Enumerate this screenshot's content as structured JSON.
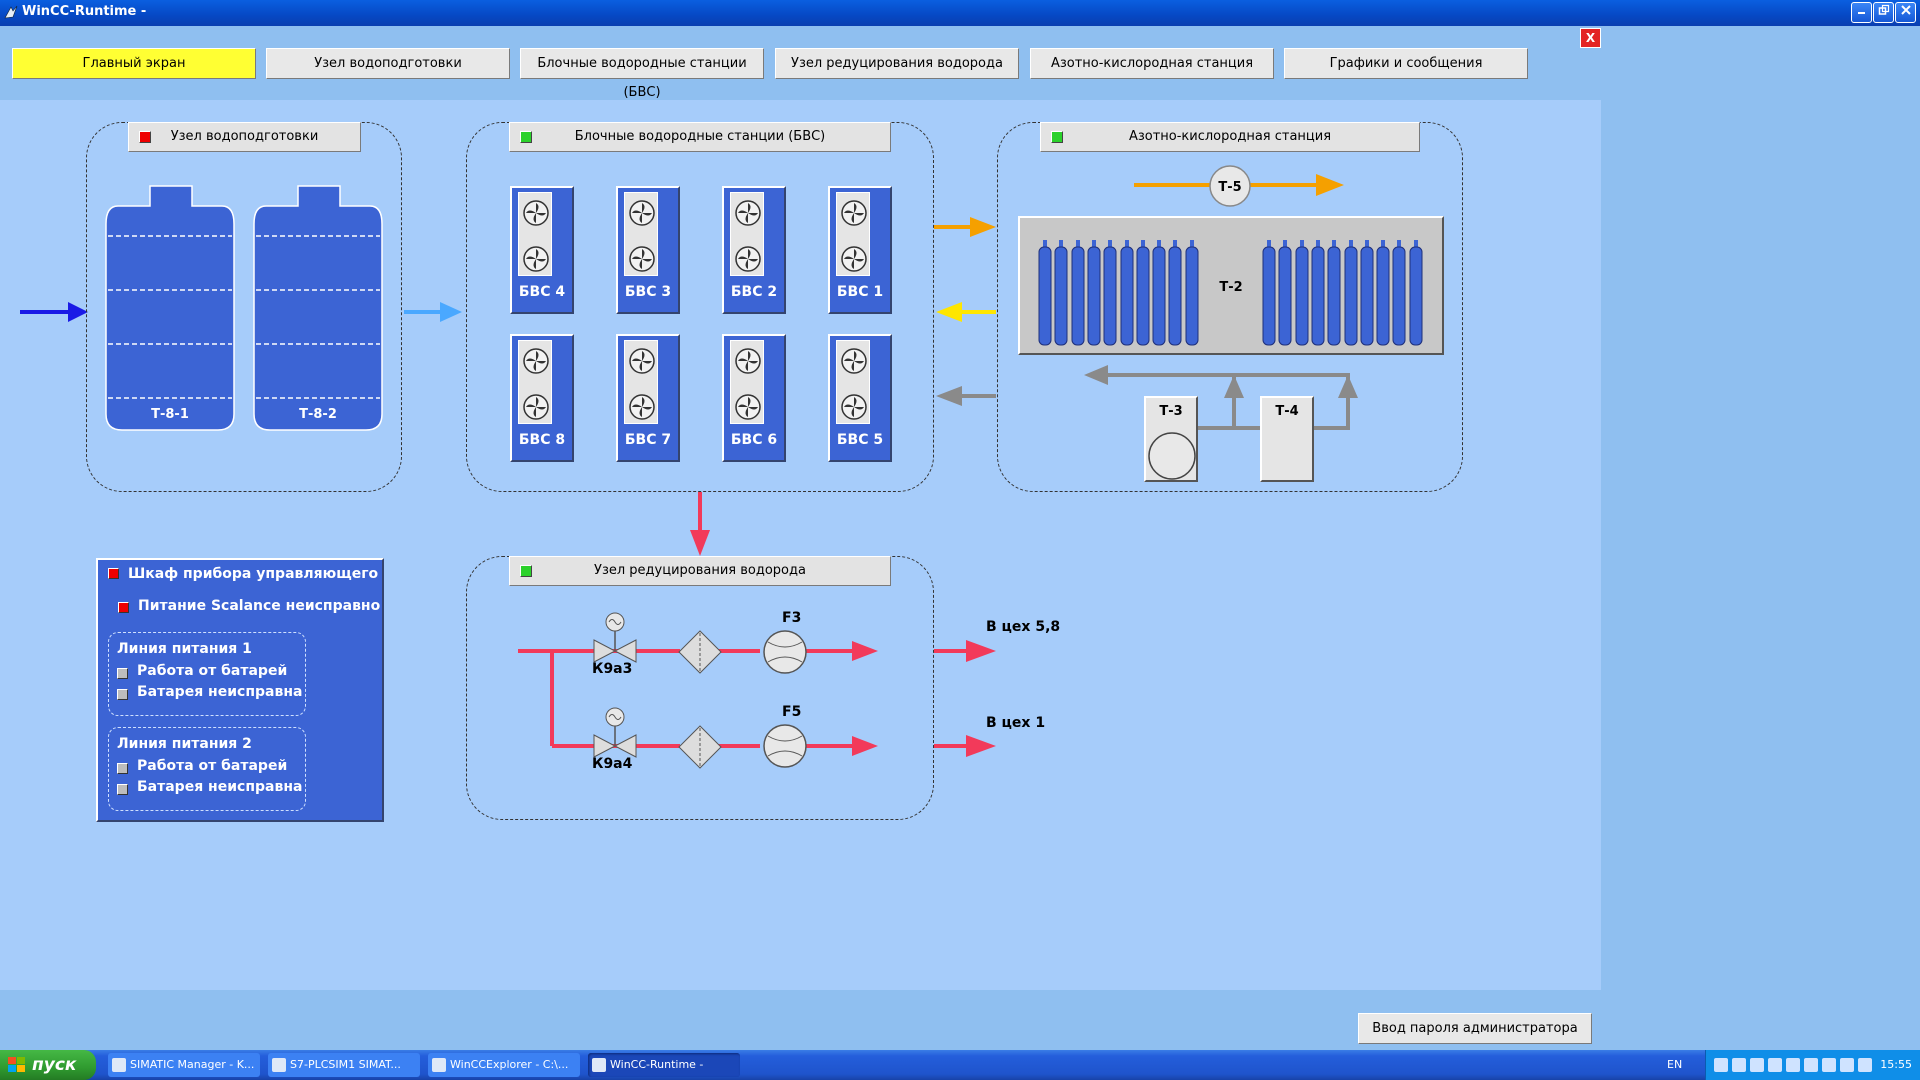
{
  "window": {
    "title": "WinCC-Runtime -",
    "close_label": "X"
  },
  "nav": [
    {
      "label": "Главный экран",
      "active": true
    },
    {
      "label": "Узел водоподготовки"
    },
    {
      "label": "Блочные водородные станции (БВС)"
    },
    {
      "label": "Узел редуцирования водорода"
    },
    {
      "label": "Азотно-кислородная станция"
    },
    {
      "label": "Графики и сообщения"
    }
  ],
  "water": {
    "title": "Узел водоподготовки",
    "status": "red",
    "tanks": [
      "Т-8-1",
      "Т-8-2"
    ]
  },
  "bvs": {
    "title": "Блочные водородные станции (БВС)",
    "status": "green",
    "units": [
      "БВС 4",
      "БВС 3",
      "БВС 2",
      "БВС 1",
      "БВС 8",
      "БВС 7",
      "БВС 6",
      "БВС 5"
    ]
  },
  "nitro": {
    "title": "Азотно-кислородная станция",
    "status": "green",
    "t5": "Т-5",
    "t2": "Т-2",
    "t3": "Т-3",
    "t4": "Т-4"
  },
  "reduce": {
    "title": "Узел редуцирования водорода",
    "status": "green",
    "valve1": "К9а3",
    "valve2": "К9а4",
    "f1": "F3",
    "f2": "F5",
    "out1": "В цех 5,8",
    "out2": "В цех 1"
  },
  "cabinet": {
    "title": "Шкаф прибора управляющего",
    "scalance": "Питание Scalance неисправно",
    "line1": {
      "title": "Линия питания 1",
      "battery_work": "Работа от батарей",
      "battery_fault": "Батарея неисправна"
    },
    "line2": {
      "title": "Линия питания 2",
      "battery_work": "Работа от батарей",
      "battery_fault": "Батарея неисправна"
    }
  },
  "admin_button": "Ввод пароля администратора",
  "taskbar": {
    "start": "пуск",
    "tasks": [
      "SIMATIC Manager - K...",
      "S7-PLCSIM1    SIMAT...",
      "WinCCExplorer - C:\\...",
      "WinCC-Runtime -"
    ],
    "lang": "EN",
    "clock": "15:55"
  },
  "colors": {
    "water_in": "#1a1ae6",
    "water_out": "#4aa8ff",
    "oxygen": "#f5a000",
    "hydrogen_yellow": "#ffe600",
    "gray_flow": "#8a8a8a",
    "hydrogen": "#f23a5a"
  }
}
